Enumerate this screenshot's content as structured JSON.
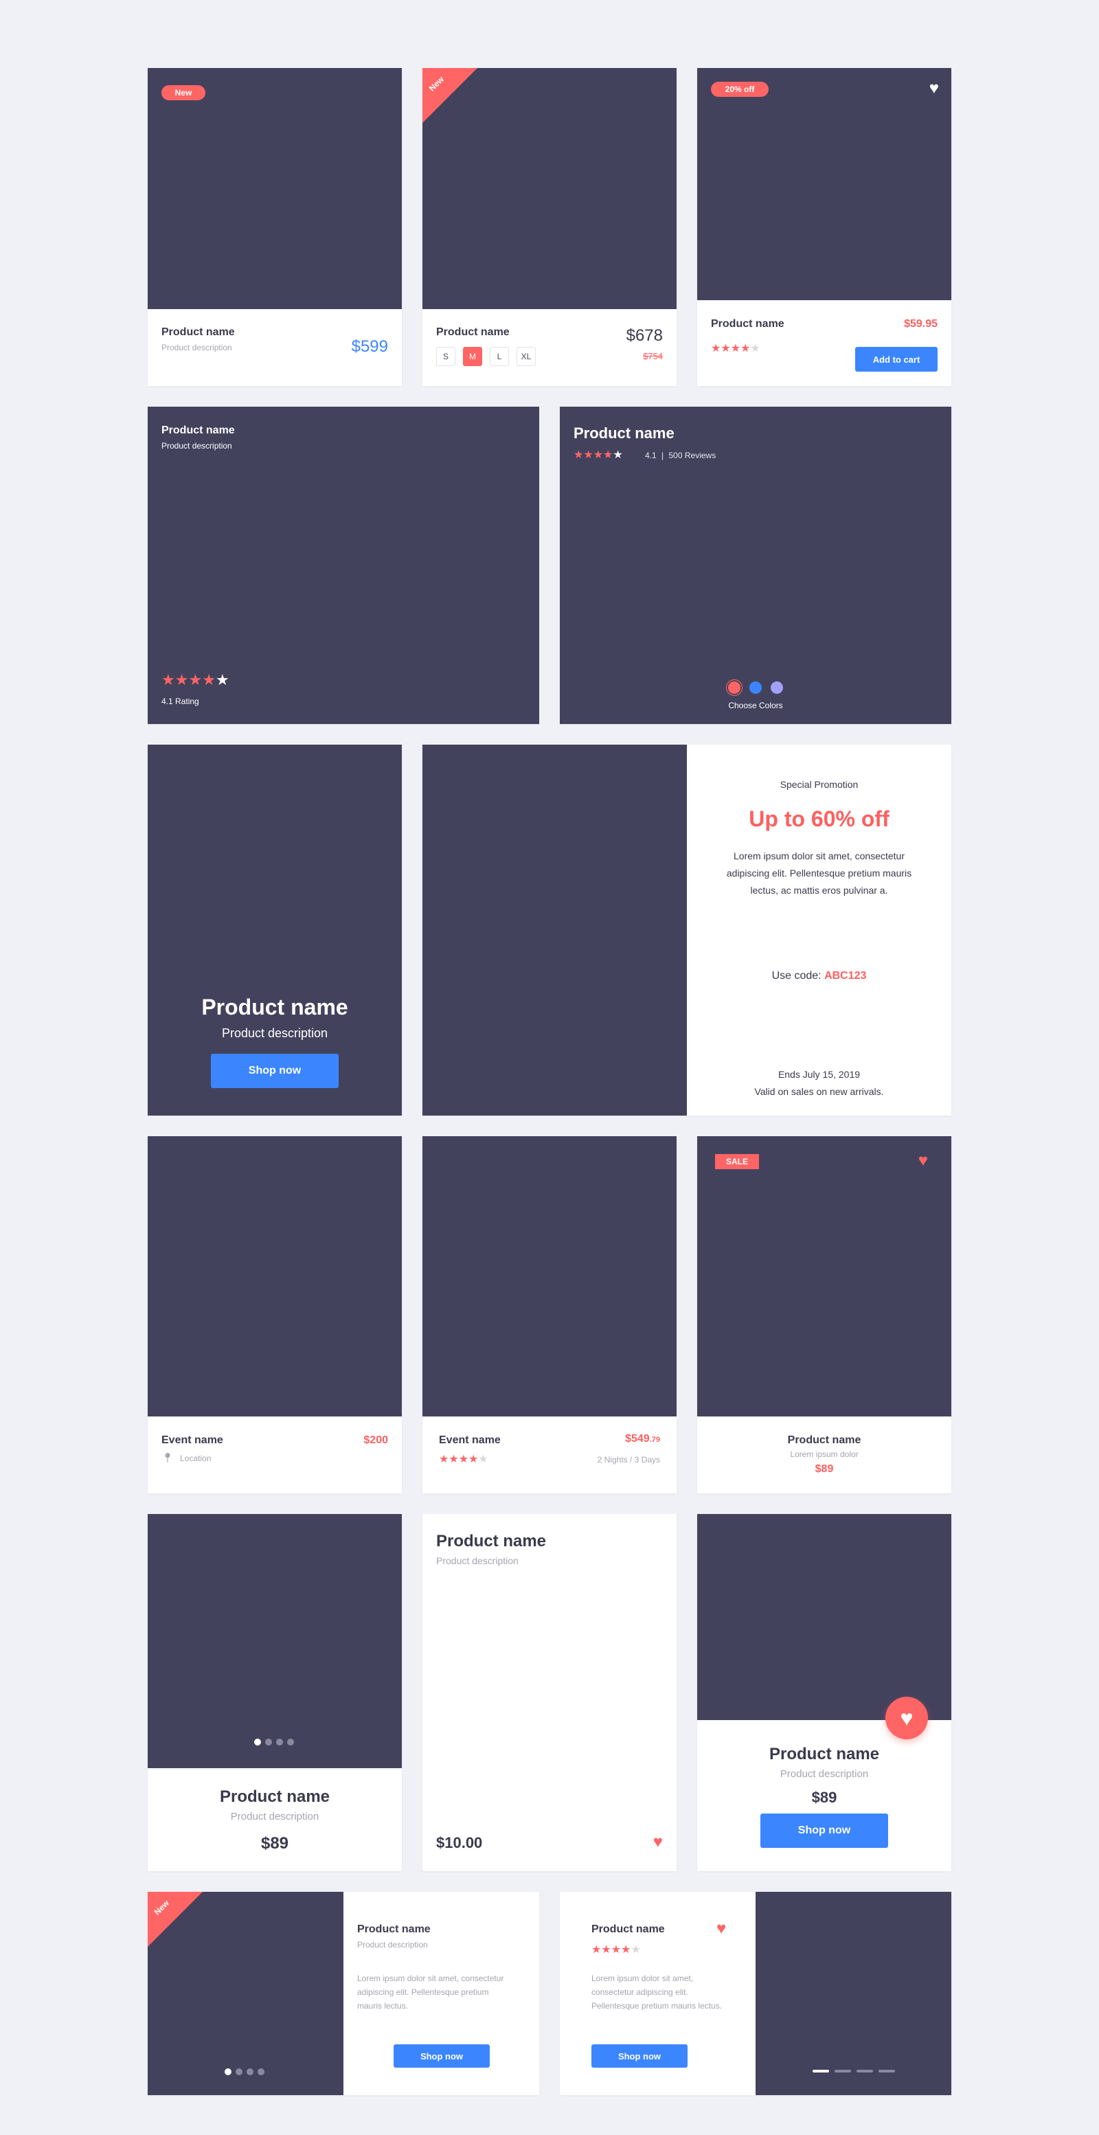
{
  "colors": {
    "background": "#f0f1f6",
    "image": "#43425d",
    "accent_red": "#ff5f5f",
    "accent_blue": "#3b86ff"
  },
  "row1": {
    "card1": {
      "badge": "New",
      "name": "Product name",
      "description": "Product description",
      "price": "$599"
    },
    "card2": {
      "ribbon": "New",
      "name": "Product name",
      "price": "$678",
      "old_price": "$754",
      "sizes": [
        "S",
        "M",
        "L",
        "XL"
      ],
      "selected_size": "M"
    },
    "card3": {
      "badge": "20% off",
      "name": "Product name",
      "price": "$59.95",
      "rating": 4,
      "add_to_cart": "Add to cart",
      "icon": "heart-icon"
    }
  },
  "row2": {
    "card1": {
      "name": "Product name",
      "description": "Product description",
      "rating": 4,
      "rating_label": "4.1 Rating"
    },
    "card2": {
      "name": "Product name",
      "rating": 4,
      "rating_value": "4.1",
      "separator": "|",
      "reviews": "500 Reviews",
      "colors_label": "Choose Colors",
      "colors": [
        "#ff6565",
        "#3b86ff",
        "#a3a0fb"
      ]
    }
  },
  "row3": {
    "card1": {
      "name": "Product name",
      "description": "Product description",
      "button": "Shop now"
    },
    "promo": {
      "eyebrow": "Special Promotion",
      "headline": "Up to 60% off",
      "body": "Lorem ipsum dolor sit amet, consectetur adipiscing elit. Pellentesque pretium mauris lectus, ac mattis eros pulvinar a.",
      "code_label": "Use code:",
      "code": "ABC123",
      "ends": "Ends July 15, 2019",
      "valid": "Valid on sales on new arrivals."
    }
  },
  "row4": {
    "card1": {
      "name": "Event name",
      "price": "$200",
      "location": "Location"
    },
    "card2": {
      "name": "Event name",
      "price_main": "$549",
      "price_cents": ".79",
      "rating": 4,
      "duration": "2 Nights / 3 Days"
    },
    "card3": {
      "badge": "SALE",
      "name": "Product name",
      "description": "Lorem ipsum dolor",
      "price": "$89"
    }
  },
  "row5": {
    "card1": {
      "name": "Product name",
      "description": "Product description",
      "price": "$89"
    },
    "card2": {
      "name": "Product name",
      "description": "Product description",
      "price": "$10.00"
    },
    "card3": {
      "name": "Product name",
      "description": "Product description",
      "price": "$89",
      "button": "Shop now"
    }
  },
  "row6": {
    "card1": {
      "ribbon": "New",
      "name": "Product name",
      "description": "Product description",
      "body": "Lorem ipsum dolor sit amet, consectetur adipiscing elit. Pellentesque pretium mauris lectus.",
      "button": "Shop now"
    },
    "card2": {
      "name": "Product name",
      "rating": 4,
      "body": "Lorem ipsum dolor sit amet, consectetur adipiscing elit. Pellentesque pretium mauris lectus.",
      "button": "Shop now"
    }
  }
}
